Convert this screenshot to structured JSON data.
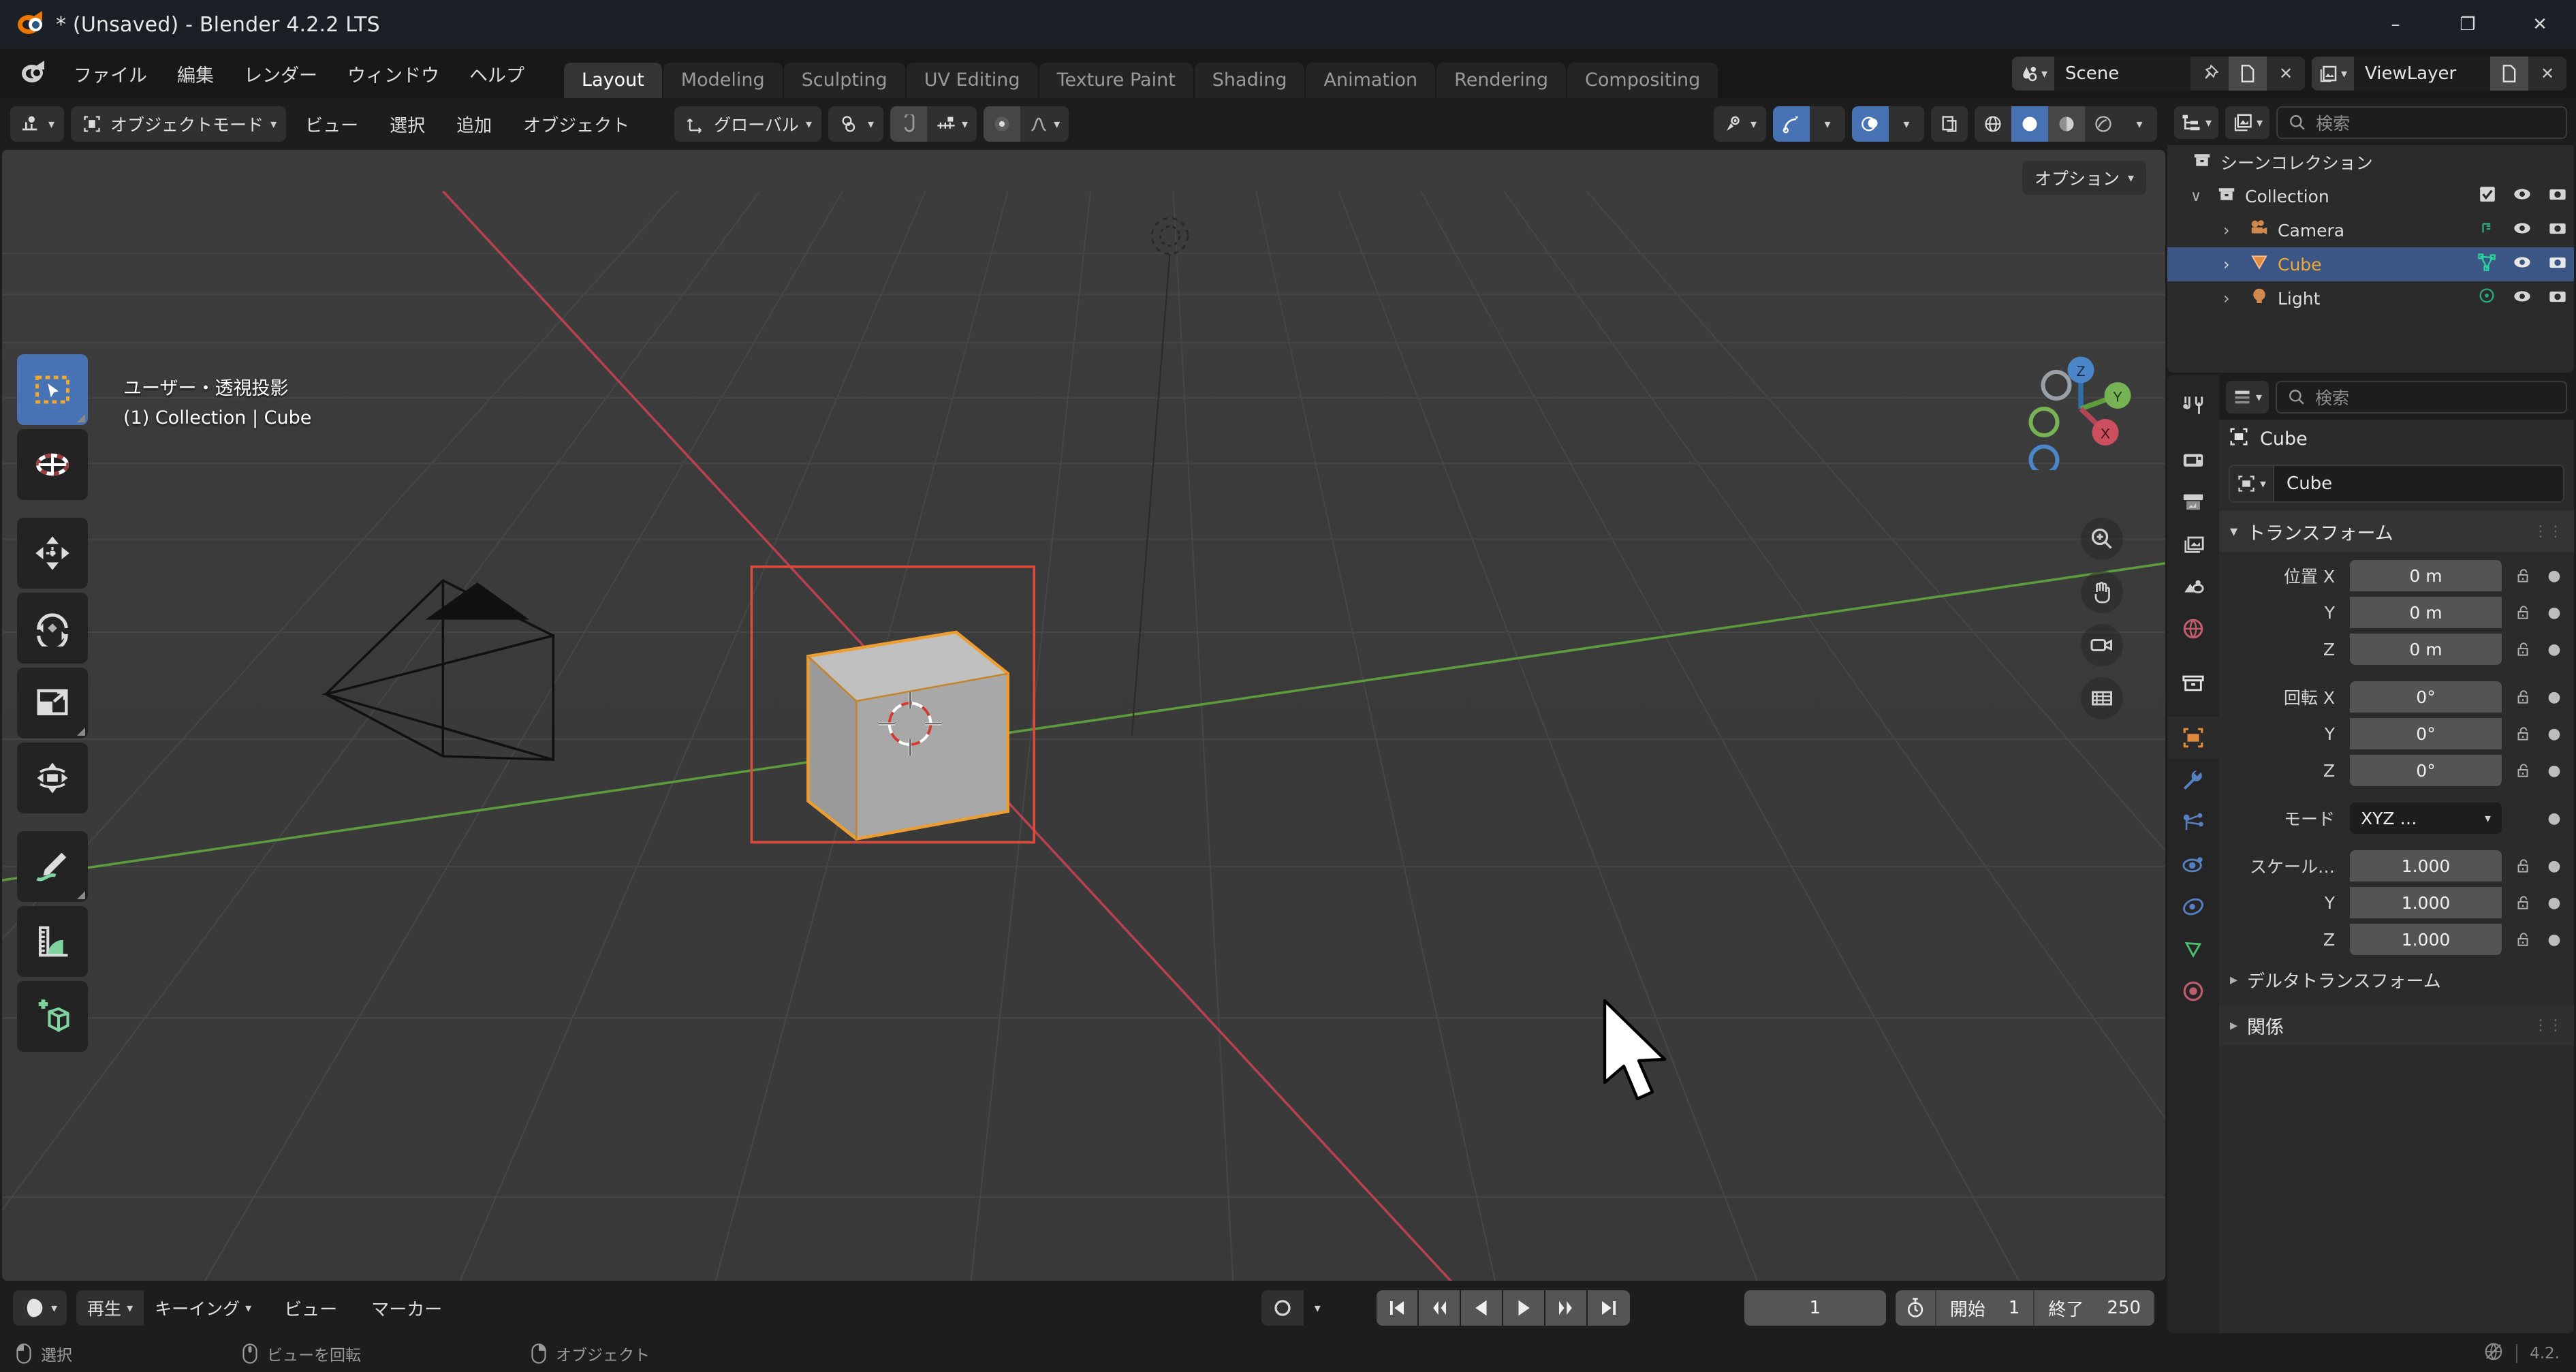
{
  "titlebar": {
    "title": "* (Unsaved) - Blender 4.2.2 LTS",
    "minimize": "–",
    "maximize": "❐",
    "close": "✕"
  },
  "topbar": {
    "menus": [
      "ファイル",
      "編集",
      "レンダー",
      "ウィンドウ",
      "ヘルプ"
    ],
    "workspaces": [
      {
        "label": "Layout",
        "active": true
      },
      {
        "label": "Modeling",
        "active": false
      },
      {
        "label": "Sculpting",
        "active": false
      },
      {
        "label": "UV Editing",
        "active": false
      },
      {
        "label": "Texture Paint",
        "active": false
      },
      {
        "label": "Shading",
        "active": false
      },
      {
        "label": "Animation",
        "active": false
      },
      {
        "label": "Rendering",
        "active": false
      },
      {
        "label": "Compositing",
        "active": false
      }
    ],
    "scene": {
      "name": "Scene",
      "pin": "pin-icon",
      "new": "new-icon",
      "unlink": "✕"
    },
    "viewlayer": {
      "name": "ViewLayer",
      "new": "new-icon",
      "unlink": "✕"
    }
  },
  "viewport": {
    "header": {
      "mode": "オブジェクトモード",
      "menus": [
        "ビュー",
        "選択",
        "追加",
        "オブジェクト"
      ],
      "orientation": "グローバル"
    },
    "overlay_line1": "ユーザー・透視投影",
    "overlay_line2": "(1) Collection | Cube",
    "options_label": "オプション",
    "gizmo_axes": [
      "Z",
      "Y",
      "X"
    ],
    "tools": [
      {
        "name": "tweak-select-box-tool",
        "active": true
      },
      {
        "name": "cursor-tool",
        "active": false
      },
      {
        "name": "move-tool",
        "active": false
      },
      {
        "name": "rotate-tool",
        "active": false
      },
      {
        "name": "scale-tool",
        "active": false
      },
      {
        "name": "transform-tool",
        "active": false
      },
      {
        "name": "annotate-tool",
        "active": false
      },
      {
        "name": "measure-tool",
        "active": false
      },
      {
        "name": "add-cube-tool",
        "active": false
      }
    ]
  },
  "timeline": {
    "menus": [
      "再生",
      "キーイング",
      "ビュー",
      "マーカー"
    ],
    "current_frame": "1",
    "start_label": "開始",
    "start_value": "1",
    "end_label": "終了",
    "end_value": "250"
  },
  "outliner": {
    "search_placeholder": "検索",
    "rows": [
      {
        "label": "シーンコレクション",
        "depth": 0,
        "icon": "scene-collection-icon",
        "selected": false,
        "expand": "",
        "orange": false,
        "checkbox": false
      },
      {
        "label": "Collection",
        "depth": 1,
        "icon": "collection-icon",
        "selected": false,
        "expand": "∨",
        "orange": false,
        "checkbox": true
      },
      {
        "label": "Camera",
        "depth": 2,
        "icon": "camera-icon",
        "selected": false,
        "expand": "›",
        "orange": false,
        "checkbox": false
      },
      {
        "label": "Cube",
        "depth": 2,
        "icon": "mesh-icon",
        "selected": true,
        "expand": "›",
        "orange": true,
        "checkbox": false
      },
      {
        "label": "Light",
        "depth": 2,
        "icon": "light-icon",
        "selected": false,
        "expand": "›",
        "orange": false,
        "checkbox": false
      }
    ]
  },
  "properties": {
    "search_placeholder": "検索",
    "breadcrumb": "Cube",
    "object_name": "Cube",
    "transform_panel": "トランスフォーム",
    "location": {
      "label": "位置 X",
      "x": "0 m",
      "y": "0 m",
      "z": "0 m",
      "ylabel": "Y",
      "zlabel": "Z"
    },
    "rotation": {
      "label": "回転 X",
      "x": "0°",
      "y": "0°",
      "z": "0°",
      "ylabel": "Y",
      "zlabel": "Z"
    },
    "mode": {
      "label": "モード",
      "value": "XYZ …"
    },
    "scale": {
      "label": "スケール…",
      "x": "1.000",
      "y": "1.000",
      "z": "1.000",
      "ylabel": "Y",
      "zlabel": "Z"
    },
    "delta_transform": "デルタトランスフォーム",
    "relations": "関係",
    "tabs": [
      {
        "name": "tool-tab",
        "color": "#d4d4d4",
        "active": false
      },
      {
        "name": "render-tab",
        "color": "#d4d4d4",
        "active": false
      },
      {
        "name": "output-tab",
        "color": "#d4d4d4",
        "active": false
      },
      {
        "name": "view-layer-tab",
        "color": "#d4d4d4",
        "active": false
      },
      {
        "name": "scene-tab",
        "color": "#d4d4d4",
        "active": false
      },
      {
        "name": "world-tab",
        "color": "#c05d6d",
        "active": false
      },
      {
        "name": "collection-tab",
        "color": "#d4d4d4",
        "active": false
      },
      {
        "name": "object-tab",
        "color": "#e08a3c",
        "active": true
      },
      {
        "name": "modifier-tab",
        "color": "#5680c2",
        "active": false
      },
      {
        "name": "particles-tab",
        "color": "#5680c2",
        "active": false
      },
      {
        "name": "physics-tab",
        "color": "#5680c2",
        "active": false
      },
      {
        "name": "constraint-tab",
        "color": "#5680c2",
        "active": false
      },
      {
        "name": "data-tab",
        "color": "#4fbf70",
        "active": false
      },
      {
        "name": "material-tab",
        "color": "#c05d6d",
        "active": false
      }
    ]
  },
  "statusbar": {
    "items": [
      {
        "label": "選択",
        "mouse": "left"
      },
      {
        "label": "ビューを回転",
        "mouse": "middle"
      },
      {
        "label": "オブジェクト",
        "mouse": "right"
      }
    ],
    "version": "4.2.",
    "network_icon": "globe-off-icon"
  },
  "colors": {
    "accent_blue": "#4772b3",
    "selection_orange": "#ed9e32",
    "viewport_bg": "#393939",
    "panel_bg": "#2b2b2b",
    "header_bg": "#1d1d1d",
    "x_axis_red": "#cd4452",
    "y_axis_green": "#60bd43",
    "outliner_select": "#3b5585"
  }
}
